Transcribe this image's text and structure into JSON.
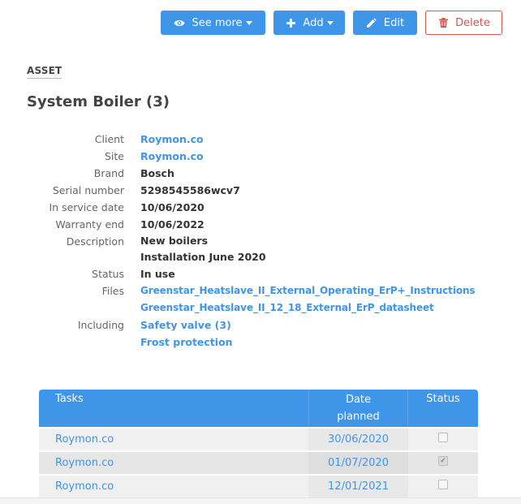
{
  "toolbar": {
    "see_more": "See more",
    "add": "Add",
    "edit": "Edit",
    "delete": "Delete"
  },
  "section_tag": "ASSET",
  "title": "System Boiler (3)",
  "details": {
    "client_label": "Client",
    "client": "Roymon.co",
    "site_label": "Site",
    "site": "Roymon.co",
    "brand_label": "Brand",
    "brand": "Bosch",
    "serial_label": "Serial number",
    "serial": "5298545586wcv7",
    "in_service_label": "In service date",
    "in_service": "10/06/2020",
    "warranty_label": "Warranty end",
    "warranty": "10/06/2022",
    "description_label": "Description",
    "description_lines": [
      "New boilers",
      "Installation June 2020"
    ],
    "status_label": "Status",
    "status": "In use",
    "files_label": "Files",
    "files": [
      "Greenstar_Heatslave_II_External_Operating_ErP+_Instructions",
      "Greenstar_Heatslave_II_12_18_External_ErP_datasheet"
    ],
    "including_label": "Including",
    "including": [
      "Safety valve (3)",
      "Frost protection"
    ]
  },
  "tasks_table": {
    "headers": {
      "tasks": "Tasks",
      "date_line1": "Date",
      "date_line2": "planned",
      "status": "Status"
    },
    "rows": [
      {
        "task": "Roymon.co",
        "date": "30/06/2020",
        "done": false
      },
      {
        "task": "Roymon.co",
        "date": "01/07/2020",
        "done": true
      },
      {
        "task": "Roymon.co",
        "date": "12/01/2021",
        "done": false
      }
    ]
  },
  "colors": {
    "accent": "#3f95e8",
    "danger": "#d9534f"
  }
}
